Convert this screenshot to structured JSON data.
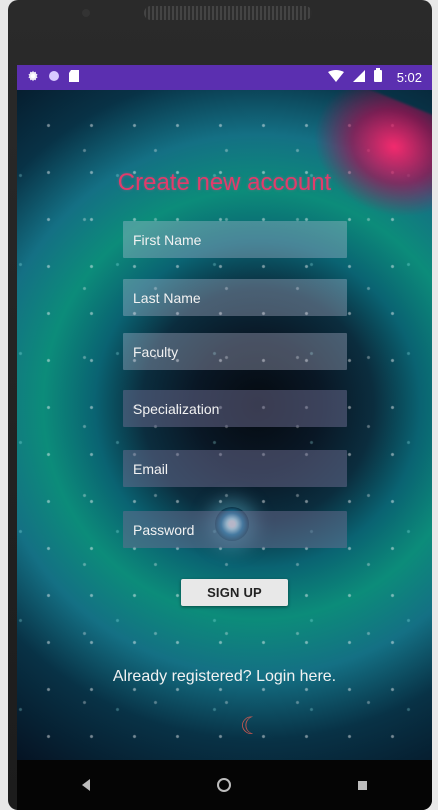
{
  "status_bar": {
    "time": "5:02",
    "left_icons": [
      "gear-icon",
      "circle-icon",
      "sd-card-icon"
    ],
    "right_icons": [
      "wifi-icon",
      "signal-icon",
      "battery-icon"
    ]
  },
  "form": {
    "title": "Create new account",
    "fields": {
      "first_name": "First Name",
      "last_name": "Last Name",
      "faculty": "Faculty",
      "specialization": "Specialization",
      "email": "Email",
      "password": "Password"
    },
    "submit_label": "SIGN UP",
    "login_link": "Already registered? Login here."
  },
  "navigation": {
    "icons": [
      "back-icon",
      "home-icon",
      "recent-apps-icon"
    ]
  },
  "theme": {
    "status_bar": "#5b2fb0",
    "title": "#e33b6b",
    "button": "#e8e8e8"
  }
}
